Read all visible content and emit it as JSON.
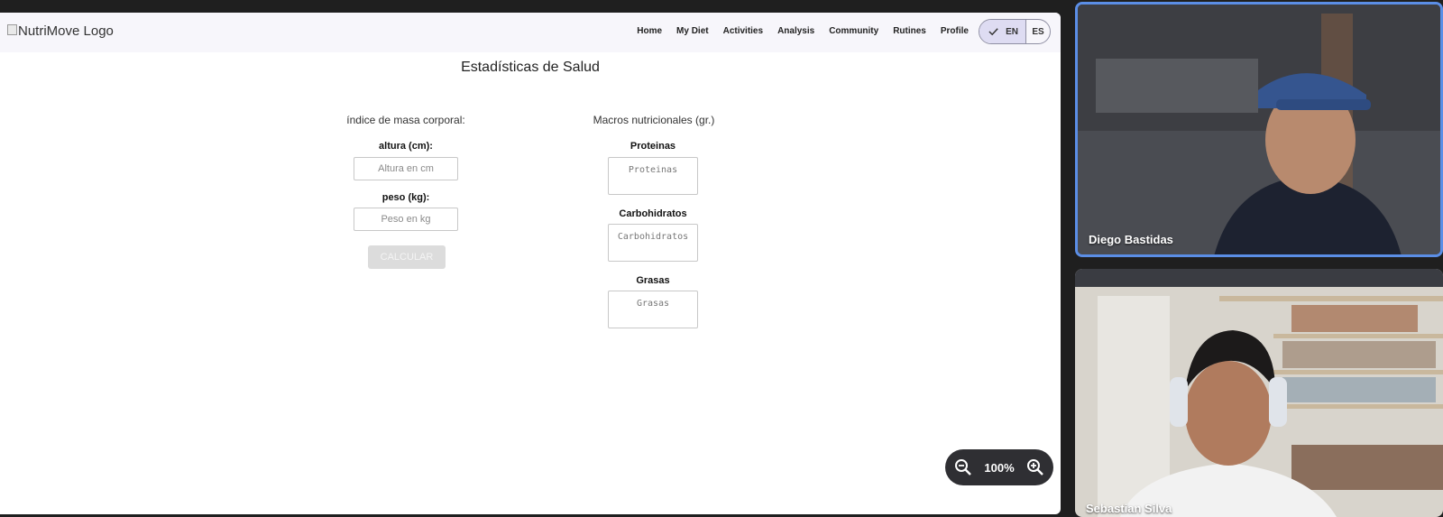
{
  "app": {
    "logo_alt": "NutriMove Logo",
    "nav": [
      "Home",
      "My Diet",
      "Activities",
      "Analysis",
      "Community",
      "Rutines",
      "Profile"
    ],
    "lang": {
      "selected": "EN",
      "other": "ES"
    }
  },
  "page": {
    "title": "Estadísticas de Salud",
    "bmi": {
      "section_title": "índice de masa corporal:",
      "height_label": "altura (cm):",
      "height_placeholder": "Altura en cm",
      "weight_label": "peso (kg):",
      "weight_placeholder": "Peso en kg",
      "calc_button": "CALCULAR"
    },
    "macros": {
      "section_title": "Macros nutricionales (gr.)",
      "protein_label": "Proteinas",
      "protein_placeholder": "Proteinas",
      "carbs_label": "Carbohidratos",
      "carbs_placeholder": "Carbohidratos",
      "fat_label": "Grasas",
      "fat_placeholder": "Grasas"
    }
  },
  "zoom": {
    "level": "100%"
  },
  "participants": [
    {
      "name": "Diego Bastidas"
    },
    {
      "name": "Sebastian Silva"
    }
  ],
  "colors": {
    "active_speaker_border": "#5b8ee6",
    "lang_selected_bg": "#dedcf2"
  }
}
